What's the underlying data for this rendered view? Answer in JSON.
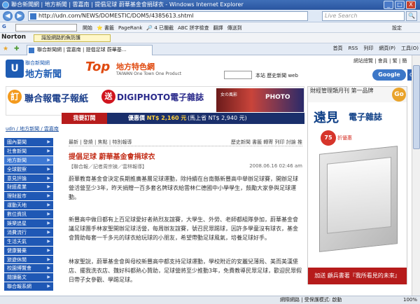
{
  "window": {
    "title": "聯合新聞網 | 地方新聞 | 雲嘉南 | 提倡足球 蔚華基金會捐球衣 - Windows Internet Explorer",
    "minimize": "_",
    "maximize": "□",
    "close": "X"
  },
  "address": {
    "url": "http://udn.com/NEWS/DOMESTIC/DOM5/4385613.shtml",
    "live_search_placeholder": "Live Search",
    "go": "🔍"
  },
  "google_toolbar": {
    "items": [
      "開始",
      "⭐ 書籤",
      "PageRank",
      "🔎 4 已攔截",
      "ABC 拼字檢查",
      "翻譯",
      "傳送到",
      "設定"
    ]
  },
  "norton": {
    "logo": "Norton",
    "check": "識設網路釣魚防護"
  },
  "tab": {
    "label": "聯合新聞網 | 雲嘉南 | 提倡足球 蔚華基...",
    "commands": [
      "首頁",
      "RSS",
      "列印",
      "網頁(P)",
      "工具(O)"
    ]
  },
  "site": {
    "brand_small": "聯合新聞網",
    "brand_big": "地方新聞",
    "brand_mark": "U",
    "top_word": "Top",
    "top_sub_cn": "地方特色網",
    "top_sub_en": "TAIWAN One Town One Product",
    "top_links": "網站總覽 | 會員 | 繁 | 簡",
    "search_tabs": "本站 歷史新聞 web",
    "google_label": "Google",
    "go": "Go"
  },
  "banner": {
    "c1": "訂",
    "title1": "聯合報電子報紙",
    "c2": "送",
    "title2": "DIGIPHOTO電子雜誌",
    "img_a": "女の風影",
    "img_b": "PHOTO",
    "subscribe": "我要訂閱",
    "price_label": "優惠價",
    "price": "NT$ 2,160 元",
    "price_note": "(馬上省 NT$ 2,940 元)"
  },
  "breadcrumb": "udn / 地方新聞 / 雲嘉南",
  "sidebar": {
    "items": [
      "國內要聞",
      "社會新聞",
      "地方新聞",
      "全球觀察",
      "意見評論",
      "財經產業",
      "理財股市",
      "運動天地",
      "數位資訊",
      "娛樂追星",
      "消費流行",
      "生活天氣",
      "健康醫藥",
      "旅遊休閒",
      "校園博覽會",
      "閱讀藝文",
      "聯合報系網"
    ]
  },
  "article": {
    "tools_left": "最新 | 發燒 | 焦點 | 特別報導",
    "tools_right": "歷史新聞 書籤 轉寄 列印 討論 推",
    "title": "提倡足球 蔚華基金會捐球衣",
    "byline": "【聯合報／記者周宗禎／雲林報導】",
    "date": "2008.06.16 02:46 am",
    "p1": "蔚華教育基金會決定長期推廣基層足球運動，除持續在台南縣新豐高中舉辦足球賽，開辦足球營活營至少3年，昨天捐贈一百多套名牌球衣給雲林仁德國中小學學生，鼓勵大家參與足球運動。",
    "p2": "新豐高中做日都有上百足球愛好者熱烈友誼賽，大學生、外勞、老師都組隊參加，蔚華基金會議足球團手林家聖開辦足球活營，每周辦友誼賽，號召民眾踢球，因許多學童沒有球衣，基金會贊助每套一千多元的球衣給玩球的小朋友，希望帶動足球風氣，培養足球好手。",
    "p3": "林家聖說，蔚華基金會與母校新豐高中都支持足球運動，學校附近的安麗兒薄局、美而美漢堡店、擺我洗衣店、魏好科都熱心贊助，足球營將至少推動3年，免費教導民眾足球，歡迎民眾假日帶子女參觀、學踢足球。"
  },
  "right_ad": {
    "header": "財經管理類月刊 第一品牌",
    "go": "Go",
    "brand": "遠見",
    "brand2": "電子雜誌",
    "discount": "75",
    "discount_label": "折優惠",
    "footer": "加送 顧兵書著『我所看見的未來』"
  },
  "status": {
    "zone": "網際網路 | 受保護模式: 啟動",
    "zoom": "100%"
  }
}
